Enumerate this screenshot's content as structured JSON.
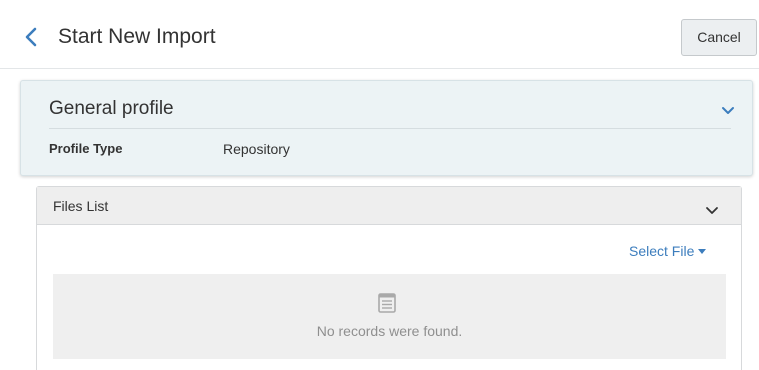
{
  "header": {
    "title": "Start New Import",
    "back_icon": "chevron-left-icon",
    "cancel_label": "Cancel"
  },
  "profile": {
    "title": "General profile",
    "toggle_icon": "chevron-down-icon",
    "type_label": "Profile Type",
    "type_value": "Repository"
  },
  "files": {
    "title": "Files List",
    "toggle_icon": "chevron-down-icon",
    "select_file_label": "Select File",
    "empty_icon": "list-icon",
    "empty_message": "No records were found."
  },
  "colors": {
    "accent": "#3c7dbd",
    "profile_background": "#ecf3f5",
    "panel_header": "#eeeeee",
    "empty_background": "#efefef"
  }
}
